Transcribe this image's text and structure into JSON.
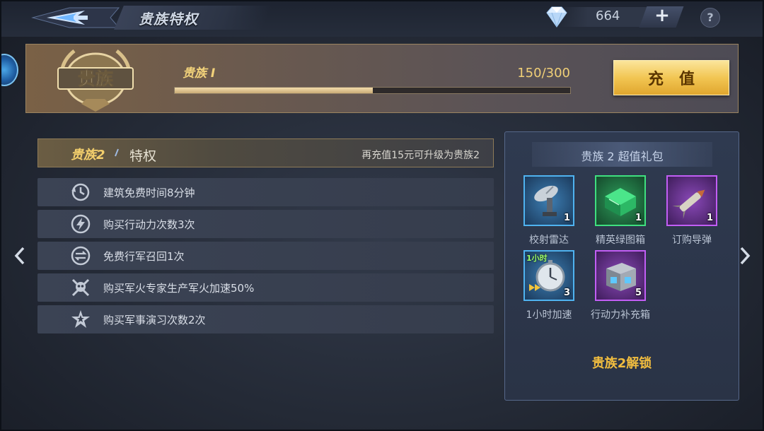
{
  "header": {
    "title": "贵族特权",
    "diamond_count": "664",
    "plus_label": "+",
    "help_label": "?"
  },
  "banner": {
    "emblem_text": "贵族",
    "level_label": "贵族 I",
    "progress_text": "150/300",
    "progress_value": 150,
    "progress_max": 300,
    "recharge_label": "充值"
  },
  "privileges": {
    "level_label": "贵族2",
    "title": "特权",
    "upgrade_hint": "再充值15元可升级为贵族2",
    "items": [
      {
        "text": "建筑免费时间8分钟",
        "icon": "clock-icon"
      },
      {
        "text": "购买行动力次数3次",
        "icon": "lightning-icon"
      },
      {
        "text": "免费行军召回1次",
        "icon": "recall-icon"
      },
      {
        "text": "购买军火专家生产军火加速50%",
        "icon": "skull-crossbones-icon"
      },
      {
        "text": "购买军事演习次数2次",
        "icon": "star-badge-icon"
      }
    ]
  },
  "gift_pack": {
    "title": "贵族 2 超值礼包",
    "items": [
      {
        "name": "校射雷达",
        "count": "1",
        "rarity": "blue",
        "icon": "radar-dish-icon"
      },
      {
        "name": "精英绿图箱",
        "count": "1",
        "rarity": "green",
        "icon": "blueprint-box-icon"
      },
      {
        "name": "订购导弹",
        "count": "1",
        "rarity": "purple",
        "icon": "missile-icon"
      },
      {
        "name": "1小时加速",
        "count": "3",
        "rarity": "blue",
        "icon": "stopwatch-icon",
        "tag": "1小时"
      },
      {
        "name": "行动力补充箱",
        "count": "5",
        "rarity": "purple",
        "icon": "supply-crate-icon"
      }
    ],
    "unlock_label": "贵族2解锁"
  },
  "colors": {
    "gold": "#f2c653",
    "unlock_text": "#f1bd3f",
    "rarity_blue": "#4fb3f0",
    "rarity_green": "#3fe07f",
    "rarity_purple": "#c25ef5"
  }
}
